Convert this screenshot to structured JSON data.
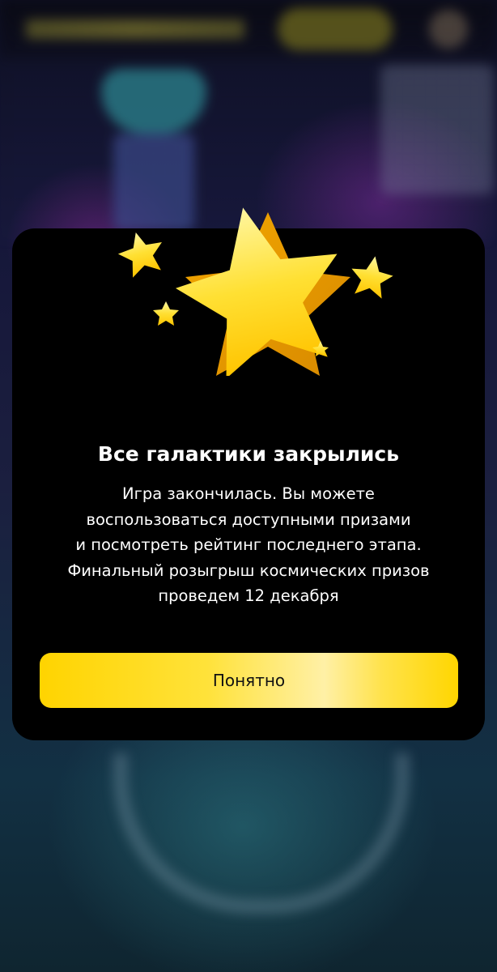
{
  "colors": {
    "modal_background": "#000000",
    "accent_yellow": "#ffd400",
    "title_text": "#ffffff",
    "button_text": "#111111"
  },
  "icons": [
    "big-star-icon",
    "small-star-icon"
  ],
  "modal": {
    "title": "Все галактики закрылись",
    "body_lines": [
      "Игра закончилась. Вы можете",
      "воспользоваться доступными призами",
      "и посмотреть рейтинг последнего этапа.",
      "Финальный розыгрыш космических призов",
      "проведем 12 декабря"
    ],
    "button_label": "Понятно"
  }
}
